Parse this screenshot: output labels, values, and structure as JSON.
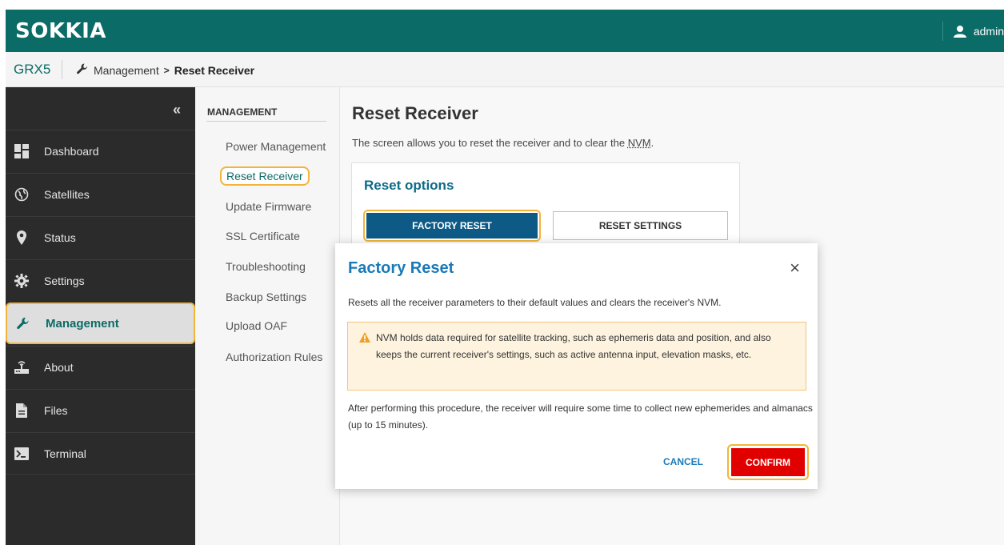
{
  "brand": "SOKKIA",
  "user": {
    "name": "admin",
    "icon": "user-icon"
  },
  "breadcrumb": {
    "device": "GRX5",
    "section": "Management",
    "arrow": ">",
    "current": "Reset Receiver",
    "icon": "wrench-icon"
  },
  "sidebar": {
    "collapse": "«",
    "items": [
      {
        "label": "Dashboard",
        "icon": "dashboard-icon"
      },
      {
        "label": "Satellites",
        "icon": "globe-icon"
      },
      {
        "label": "Status",
        "icon": "location-pin-icon"
      },
      {
        "label": "Settings",
        "icon": "gear-icon"
      },
      {
        "label": "Management",
        "icon": "wrench-icon",
        "active": true
      },
      {
        "label": "About",
        "icon": "receiver-icon"
      },
      {
        "label": "Files",
        "icon": "file-icon"
      },
      {
        "label": "Terminal",
        "icon": "terminal-icon"
      }
    ]
  },
  "submenu": {
    "title": "MANAGEMENT",
    "items": [
      "Power Management",
      "Reset Receiver",
      "Update Firmware",
      "SSL Certificate",
      "Troubleshooting",
      "Backup Settings",
      "Upload OAF",
      "Authorization Rules"
    ],
    "active_index": 1
  },
  "main": {
    "title": "Reset Receiver",
    "desc_prefix": "The screen allows you to reset the receiver and to clear the ",
    "desc_nvm": "NVM",
    "desc_suffix": ".",
    "card_title": "Reset options",
    "factory_reset": "FACTORY RESET",
    "reset_settings": "RESET SETTINGS"
  },
  "modal": {
    "title": "Factory Reset",
    "close": "×",
    "text1": "Resets all the receiver parameters to their default values and clears the receiver's NVM.",
    "warning": "NVM holds data required for satellite tracking, such as ephemeris data and position, and also keeps the current receiver's settings, such as active antenna input, elevation masks, etc.",
    "text2": "After performing this procedure, the receiver will require some time to collect new ephemerides and almanacs (up to 15 minutes).",
    "cancel": "CANCEL",
    "confirm": "CONFIRM"
  },
  "colors": {
    "header": "#0b6b66",
    "sidebar": "#2b2b2b",
    "accent_blue": "#1a7ab8",
    "primary_button": "#0d5a86",
    "confirm": "#e00000",
    "highlight": "#f2b53a"
  }
}
